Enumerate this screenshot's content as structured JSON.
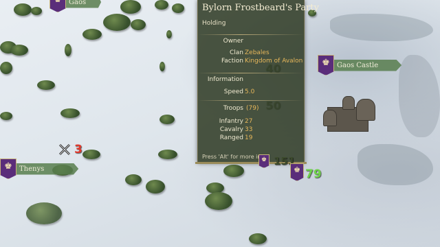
{
  "map": {
    "settlements": [
      {
        "name": "Gaos",
        "icon": "purple-banner-icon"
      },
      {
        "name": "Gaos Castle",
        "icon": "purple-banner-icon"
      },
      {
        "name": "Thenys",
        "icon": "purple-banner-icon"
      }
    ],
    "party_counts": {
      "enemy": "3",
      "party_main": "79",
      "party_near": "151",
      "party_ghost_1": "40",
      "party_ghost_2": "50"
    },
    "colors": {
      "enemy": "#e03a2e",
      "friendly": "#6fd14a",
      "banner": "#5a2d7a"
    }
  },
  "tooltip": {
    "title": "Bylorn Frostbeard's Party",
    "status": "Holding",
    "owner_header": "Owner",
    "clan_label": "Clan",
    "clan_value": "Zebales",
    "faction_label": "Faction",
    "faction_value": "Kingdom of Avalon",
    "information_header": "Information",
    "speed_label": "Speed",
    "speed_value": "5.0",
    "troops_label": "Troops",
    "troops_value": "(79)",
    "infantry_label": "Infantry",
    "infantry_value": "27",
    "cavalry_label": "Cavalry",
    "cavalry_value": "33",
    "ranged_label": "Ranged",
    "ranged_value": "19",
    "hint": "Press 'Alt' for more info."
  }
}
